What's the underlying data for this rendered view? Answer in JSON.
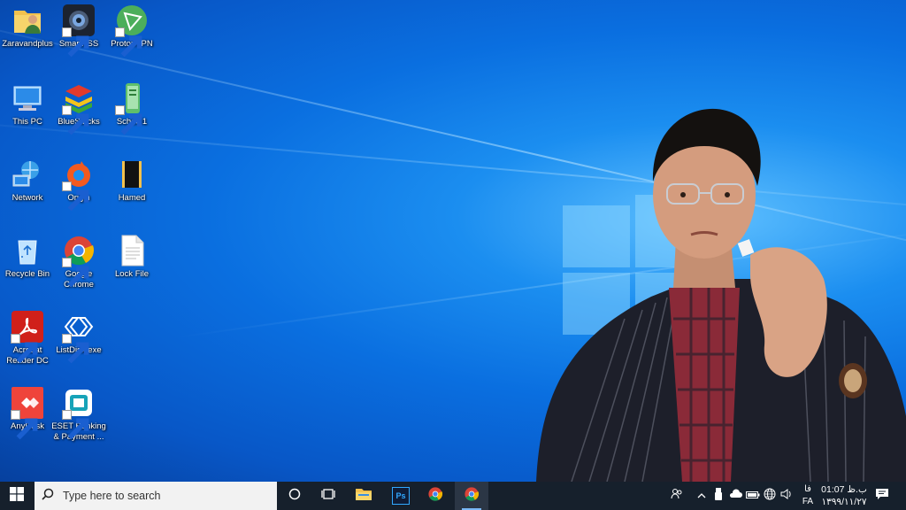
{
  "desktop": {
    "icons": [
      {
        "label": "Zaravandplus",
        "icon": "folder-user-icon"
      },
      {
        "label": "SmartPSS",
        "icon": "camera-icon"
      },
      {
        "label": "ProtonVPN",
        "icon": "vpn-icon"
      },
      {
        "label": "This PC",
        "icon": "computer-icon"
      },
      {
        "label": "BlueStacks",
        "icon": "bluestacks-icon"
      },
      {
        "label": "School1",
        "icon": "school-icon"
      },
      {
        "label": "Network",
        "icon": "network-icon"
      },
      {
        "label": "Origin",
        "icon": "origin-icon"
      },
      {
        "label": "Hamed",
        "icon": "folder-icon"
      },
      {
        "label": "Recycle Bin",
        "icon": "recycle-bin-icon"
      },
      {
        "label": "Google Chrome",
        "icon": "chrome-icon"
      },
      {
        "label": "Lock File",
        "icon": "text-file-icon"
      },
      {
        "label": "Acrobat Reader DC",
        "icon": "acrobat-icon"
      },
      {
        "label": "ListDisk.exe",
        "icon": "listdisk-icon"
      },
      {
        "label": "AnyDesk",
        "icon": "anydesk-icon"
      },
      {
        "label": "ESET Banking & Payment ...",
        "icon": "eset-icon"
      }
    ]
  },
  "taskbar": {
    "search_placeholder": "Type here to search",
    "pinned": [
      {
        "name": "task-view",
        "icon": "task-view-icon"
      },
      {
        "name": "timeline",
        "icon": "timeline-icon"
      },
      {
        "name": "file-explorer",
        "icon": "folder-icon"
      },
      {
        "name": "photoshop",
        "icon": "photoshop-icon",
        "text": "Ps"
      },
      {
        "name": "chrome",
        "icon": "chrome-icon"
      },
      {
        "name": "chrome-active",
        "icon": "chrome-icon"
      }
    ],
    "tray": {
      "language_top": "فا",
      "language_bottom": "FA",
      "time": "01:07 ب.ظ",
      "date": "۱۳۹۹/۱۱/۲۷"
    }
  },
  "colors": {
    "taskbar": "#16202c",
    "desktop_blue": "#0a6fe0",
    "accent": "#7ab8f5"
  }
}
